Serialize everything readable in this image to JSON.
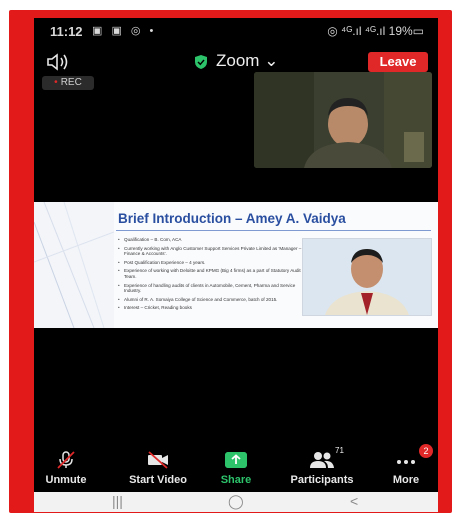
{
  "status_bar": {
    "time": "11:12",
    "notification_icons": "▣ ▣ ◎ •",
    "right_text": "◎ ⁴ᴳ.ıl ⁴ᴳ.ıl 19%▭"
  },
  "meeting": {
    "title": "Zoom",
    "title_chevron": "⌄",
    "leave_label": "Leave",
    "rec_label": "REC"
  },
  "slide": {
    "title": "Brief Introduction – Amey  A. Vaidya",
    "bullets": [
      "Qualification – B. Com, ACA",
      "Currently working with Anglo Customer Support Services Private Limited as 'Manager – Finance & Accounts'.",
      "Post Qualification Experience – 4 years.",
      "Experience of working with Deloitte and KPMG (Big 4 firms) as a part of Statutory Audit Team.",
      "Experience of handling audits of clients in Automobile, Cement, Pharma and Service Industry.",
      "Alumni of R. A. Somaiya College of Science and Commerce, batch of 2015.",
      "Interest – Cricket, Reading books"
    ]
  },
  "toolbar": {
    "unmute_label": "Unmute",
    "start_video_label": "Start Video",
    "share_label": "Share",
    "participants_label": "Participants",
    "participants_count": "71",
    "more_label": "More",
    "more_badge": "2"
  },
  "nav_bar": {
    "recent_glyph": "|||",
    "home_glyph": "◯",
    "back_glyph": "<"
  },
  "colors": {
    "frame": "#e21a1a",
    "leave": "#e02828",
    "share": "#2cc36b",
    "slide_title": "#2a4fa0"
  }
}
